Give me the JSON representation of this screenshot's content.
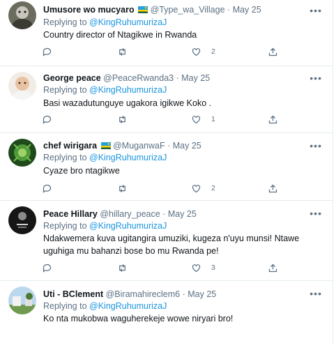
{
  "replying_prefix": "Replying to",
  "reply_target": "@KingRuhumurizaJ",
  "more_icon": "•••",
  "tweets": [
    {
      "name": "Umusore wo mucyaro",
      "flag": "rwanda-flag-icon",
      "handle": "@Type_wa_Village",
      "sep": "·",
      "date": "May 25",
      "text": "Country director of Ntagikwe in Rwanda",
      "likes": "2"
    },
    {
      "name": "George peace",
      "handle": "@PeaceRwanda3",
      "sep": "·",
      "date": "May 25",
      "text": "Basi wazadutunguye ugakora  igikwe Koko .",
      "likes": "1"
    },
    {
      "name": "chef wirigara",
      "flag": "rwanda-flag-icon",
      "handle": "@MuganwaF",
      "sep": "·",
      "date": "May 25",
      "text": "Cyaze bro ntagikwe",
      "likes": "2"
    },
    {
      "name": "Peace Hillary",
      "handle": "@hillary_peace",
      "sep": "·",
      "date": "May 25",
      "text": "Ndakwemera kuva ugitangira umuziki, kugeza n'uyu munsi! Ntawe uguhiga mu bahanzi bose bo mu Rwanda pe!",
      "likes": "3"
    },
    {
      "name": "Uti - BClement",
      "handle": "@Biramahireclem6",
      "sep": "·",
      "date": "May 25",
      "text": "Ko nta mukobwa waguherekeje wowe niryari bro!",
      "likes": ""
    }
  ],
  "colors": {
    "link": "#1b95e0",
    "muted": "#5b7083",
    "border": "#e6ecf0"
  }
}
